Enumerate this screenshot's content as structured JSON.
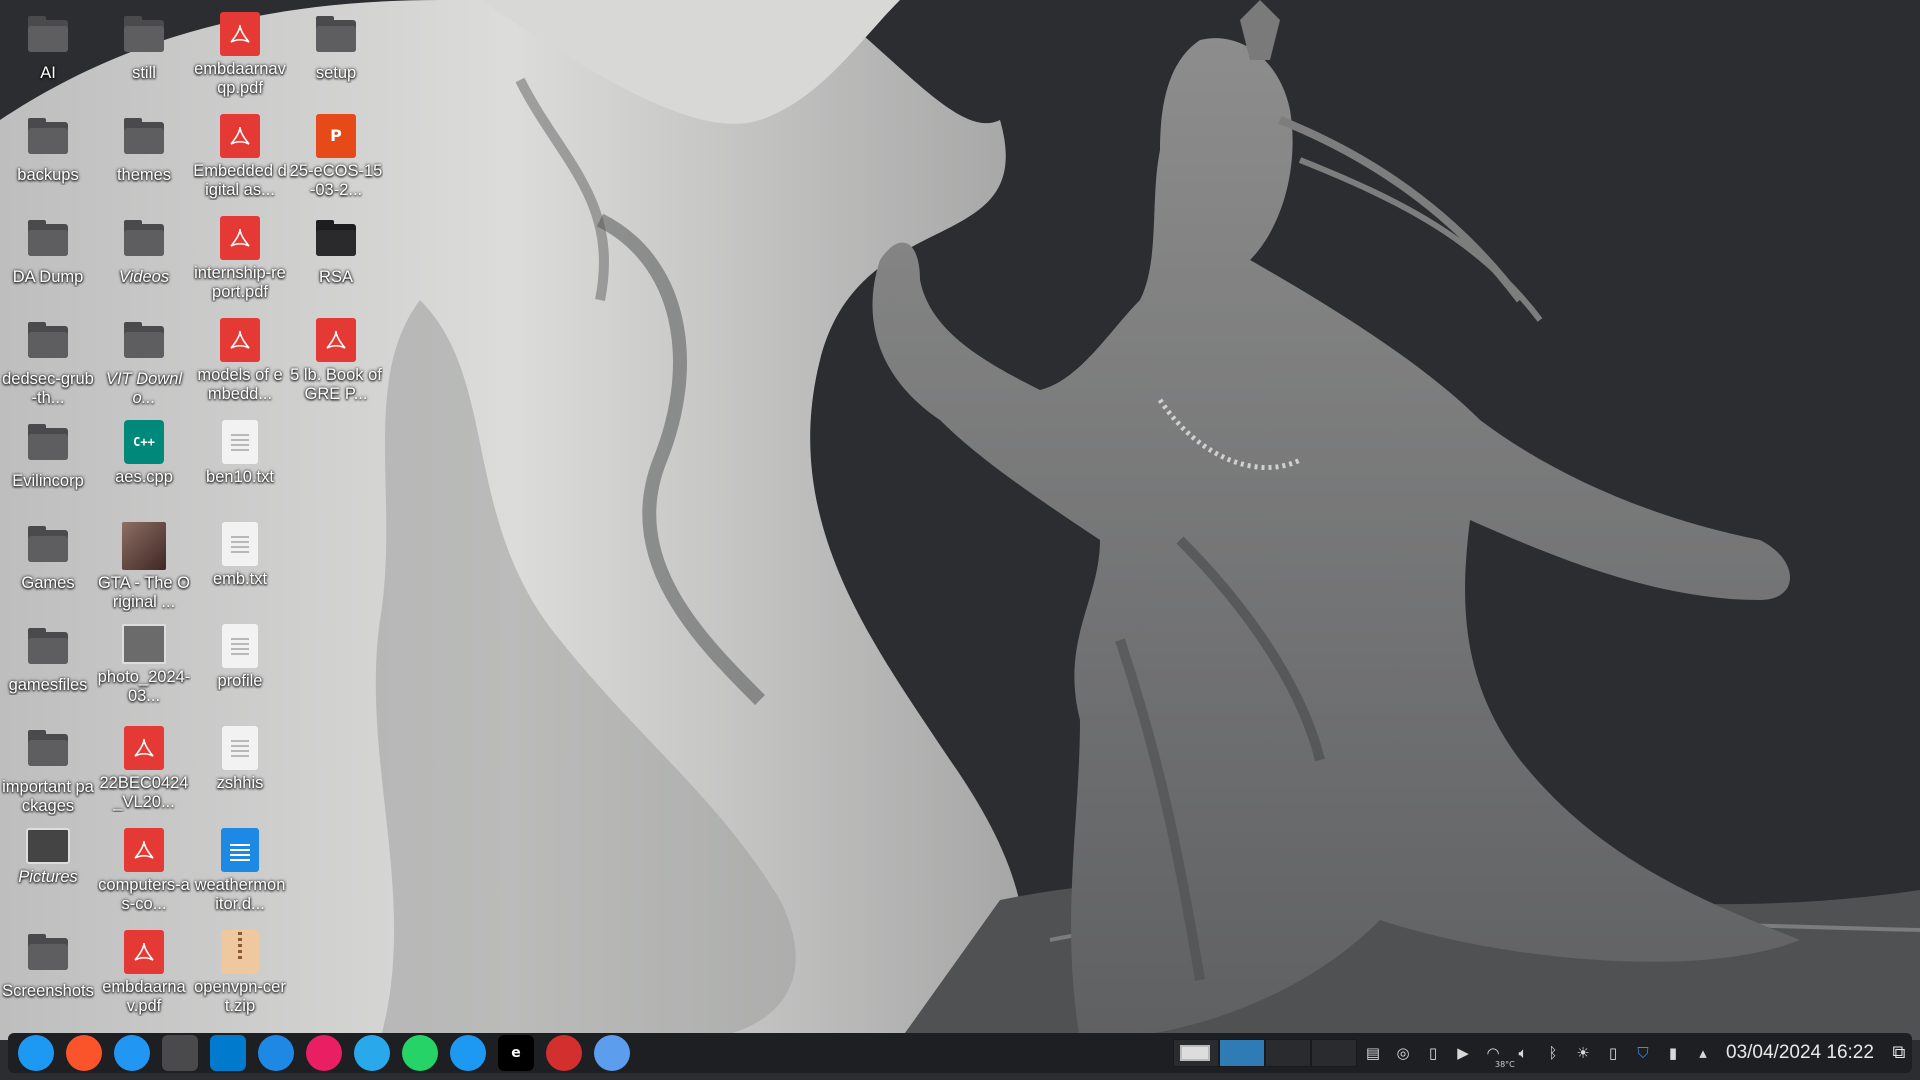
{
  "wallpaper": {
    "colors": {
      "background": "#2b2d30",
      "wave": "#cfd0cf",
      "figure": "#8a8a8a"
    }
  },
  "desktop": {
    "icons": [
      {
        "label": "AI",
        "type": "folder",
        "italic": false
      },
      {
        "label": "backups",
        "type": "folder",
        "italic": false
      },
      {
        "label": "DA Dump",
        "type": "folder",
        "italic": false
      },
      {
        "label": "dedsec-grub-th...",
        "type": "folder",
        "italic": false
      },
      {
        "label": "Evilincorp",
        "type": "folder",
        "italic": false
      },
      {
        "label": "Games",
        "type": "folder",
        "italic": false
      },
      {
        "label": "gamesfiles",
        "type": "folder",
        "italic": false
      },
      {
        "label": "important packages",
        "type": "folder",
        "italic": false
      },
      {
        "label": "Pictures",
        "type": "pictures",
        "italic": true
      },
      {
        "label": "Screenshots",
        "type": "folder",
        "italic": false
      },
      {
        "label": "still",
        "type": "folder",
        "italic": false
      },
      {
        "label": "themes",
        "type": "folder",
        "italic": false
      },
      {
        "label": "Videos",
        "type": "folder",
        "italic": true
      },
      {
        "label": "VIT Downlo...",
        "type": "folder",
        "italic": true
      },
      {
        "label": "aes.cpp",
        "type": "cpp",
        "italic": false
      },
      {
        "label": "GTA - The Original ...",
        "type": "game",
        "italic": false
      },
      {
        "label": "photo_2024-03...",
        "type": "image",
        "italic": false
      },
      {
        "label": "22BEC0424_VL20...",
        "type": "pdf",
        "italic": false
      },
      {
        "label": "computers-as-co...",
        "type": "pdf",
        "italic": false
      },
      {
        "label": "embdaarnav.pdf",
        "type": "pdf",
        "italic": false
      },
      {
        "label": "embdaarnavqp.pdf",
        "type": "pdf",
        "italic": false
      },
      {
        "label": "Embedded digital as...",
        "type": "pdf",
        "italic": false
      },
      {
        "label": "internship-report.pdf",
        "type": "pdf",
        "italic": false
      },
      {
        "label": "models of embedd...",
        "type": "pdf",
        "italic": false
      },
      {
        "label": "ben10.txt",
        "type": "txt",
        "italic": false
      },
      {
        "label": "emb.txt",
        "type": "txt",
        "italic": false
      },
      {
        "label": "profile",
        "type": "txt",
        "italic": false
      },
      {
        "label": "zshhis",
        "type": "txt",
        "italic": false
      },
      {
        "label": "weathermonitor.d...",
        "type": "doc",
        "italic": false
      },
      {
        "label": "openvpn-cert.zip",
        "type": "zip",
        "italic": false
      },
      {
        "label": "setup",
        "type": "folder",
        "italic": false
      },
      {
        "label": "25-eCOS-15-03-2...",
        "type": "ppt",
        "italic": false
      },
      {
        "label": "RSA",
        "type": "folder-dark",
        "italic": false
      },
      {
        "label": "5 lb. Book of GRE P...",
        "type": "pdf",
        "italic": false
      }
    ]
  },
  "taskbar": {
    "apps": [
      {
        "icon": "kde-launcher-icon",
        "color": "#1d99f3",
        "text": ""
      },
      {
        "icon": "brave-browser-icon",
        "color": "#fb542b",
        "text": ""
      },
      {
        "icon": "safari-browser-icon",
        "color": "#2196f3",
        "text": ""
      },
      {
        "icon": "file-manager-icon",
        "color": "#4a4a4c",
        "text": ""
      },
      {
        "icon": "vscode-icon",
        "color": "#007acc",
        "text": ""
      },
      {
        "icon": "messenger-icon",
        "color": "#1e88e5",
        "text": ""
      },
      {
        "icon": "media-player-icon",
        "color": "#e91e63",
        "text": ""
      },
      {
        "icon": "telegram-icon",
        "color": "#29a9eb",
        "text": ""
      },
      {
        "icon": "whatsapp-icon",
        "color": "#25d366",
        "text": ""
      },
      {
        "icon": "discover-icon",
        "color": "#1d99f3",
        "text": ""
      },
      {
        "icon": "epic-games-icon",
        "color": "#000000",
        "text": "e"
      },
      {
        "icon": "ebook-reader-icon",
        "color": "#d32f2f",
        "text": ""
      },
      {
        "icon": "toggle-app-icon",
        "color": "#5c9ded",
        "text": ""
      }
    ],
    "pager": {
      "desktops": 4,
      "active_index": 1
    },
    "tray": {
      "temperature": "38°C",
      "clock": "03/04/2024 16:22"
    }
  }
}
